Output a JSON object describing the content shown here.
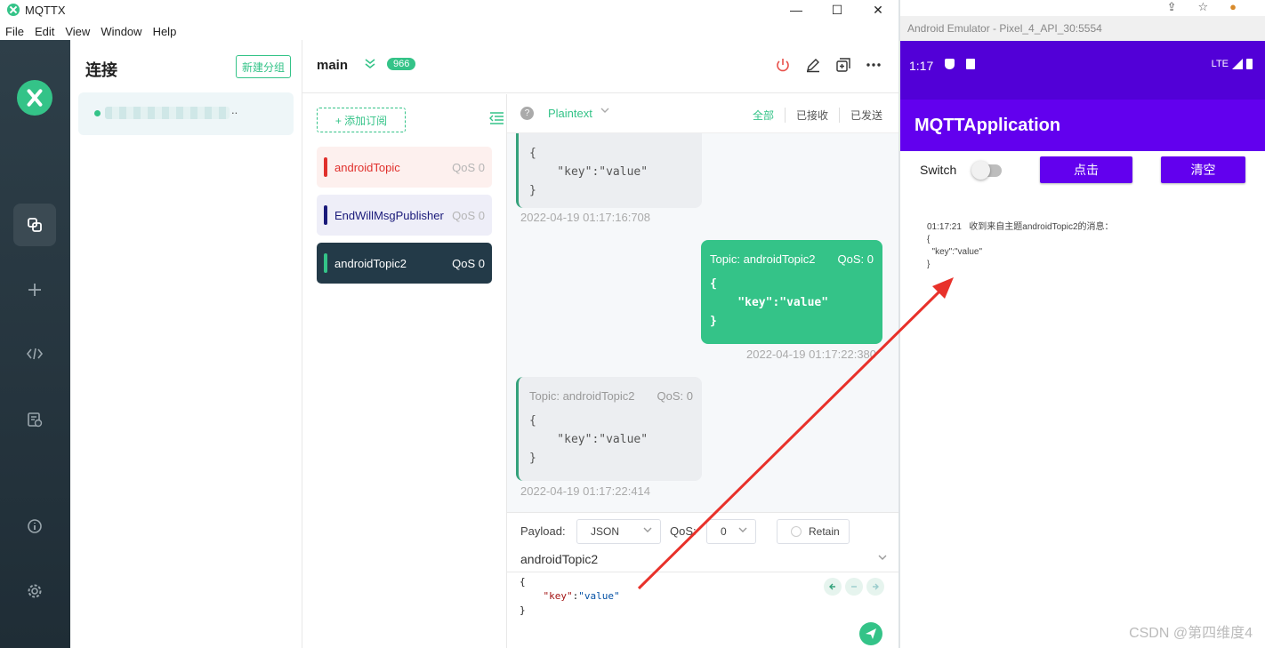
{
  "mqttx": {
    "app_title": "MQTTX",
    "window_controls": [
      "—",
      "☐",
      "✕"
    ],
    "menu": [
      "File",
      "Edit",
      "View",
      "Window",
      "Help"
    ],
    "connections": {
      "title": "连接",
      "new_group_label": "新建分组",
      "item_more": ".."
    },
    "header": {
      "title": "main",
      "count": "966"
    },
    "subscriptions": {
      "add_label": "+  添加订阅",
      "items": [
        {
          "topic": "androidTopic",
          "qos": "QoS 0",
          "color": "#e0302c"
        },
        {
          "topic": "EndWillMsgPublisher",
          "qos": "QoS 0",
          "color": "#1a1a7a"
        },
        {
          "topic": "androidTopic2",
          "qos": "QoS 0",
          "color": "#34c388"
        }
      ]
    },
    "messages": {
      "format": "Plaintext",
      "help": "?",
      "filters": [
        "全部",
        "已接收",
        "已发送"
      ],
      "list": [
        {
          "type": "recv",
          "topic": "",
          "qos": "",
          "payload": "{\n    \"key\":\"value\"\n}",
          "time": "2022-04-19 01:17:16:708"
        },
        {
          "type": "sent",
          "topic": "Topic: androidTopic2",
          "qos": "QoS: 0",
          "payload": "{\n    \"key\":\"value\"\n}",
          "time": "2022-04-19 01:17:22:380"
        },
        {
          "type": "recv",
          "topic": "Topic: androidTopic2",
          "qos": "QoS: 0",
          "payload": "{\n    \"key\":\"value\"\n}",
          "time": "2022-04-19 01:17:22:414"
        }
      ]
    },
    "publish": {
      "payload_label": "Payload:",
      "payload_type": "JSON",
      "qos_label": "QoS:",
      "qos_value": "0",
      "retain_label": "Retain",
      "topic": "androidTopic2",
      "editor_open": "{",
      "editor_key": "\"key\"",
      "editor_colon": ":",
      "editor_value": "\"value\"",
      "editor_close": "}"
    }
  },
  "emulator": {
    "title": "Android Emulator - Pixel_4_API_30:5554",
    "status_time": "1:17",
    "network": "LTE",
    "app_title": "MQTTApplication",
    "switch_label": "Switch",
    "switch_on": false,
    "click_button": "点击",
    "clear_button": "清空",
    "log": "01:17:21   收到来自主题androidTopic2的消息：\n{\n  \"key\":\"value\"\n}"
  },
  "watermark": "CSDN @第四维度4",
  "colors": {
    "accent": "#34c388",
    "android_primary": "#6200ee",
    "android_status": "#5200d7",
    "annotation_arrow": "#e8312a"
  }
}
